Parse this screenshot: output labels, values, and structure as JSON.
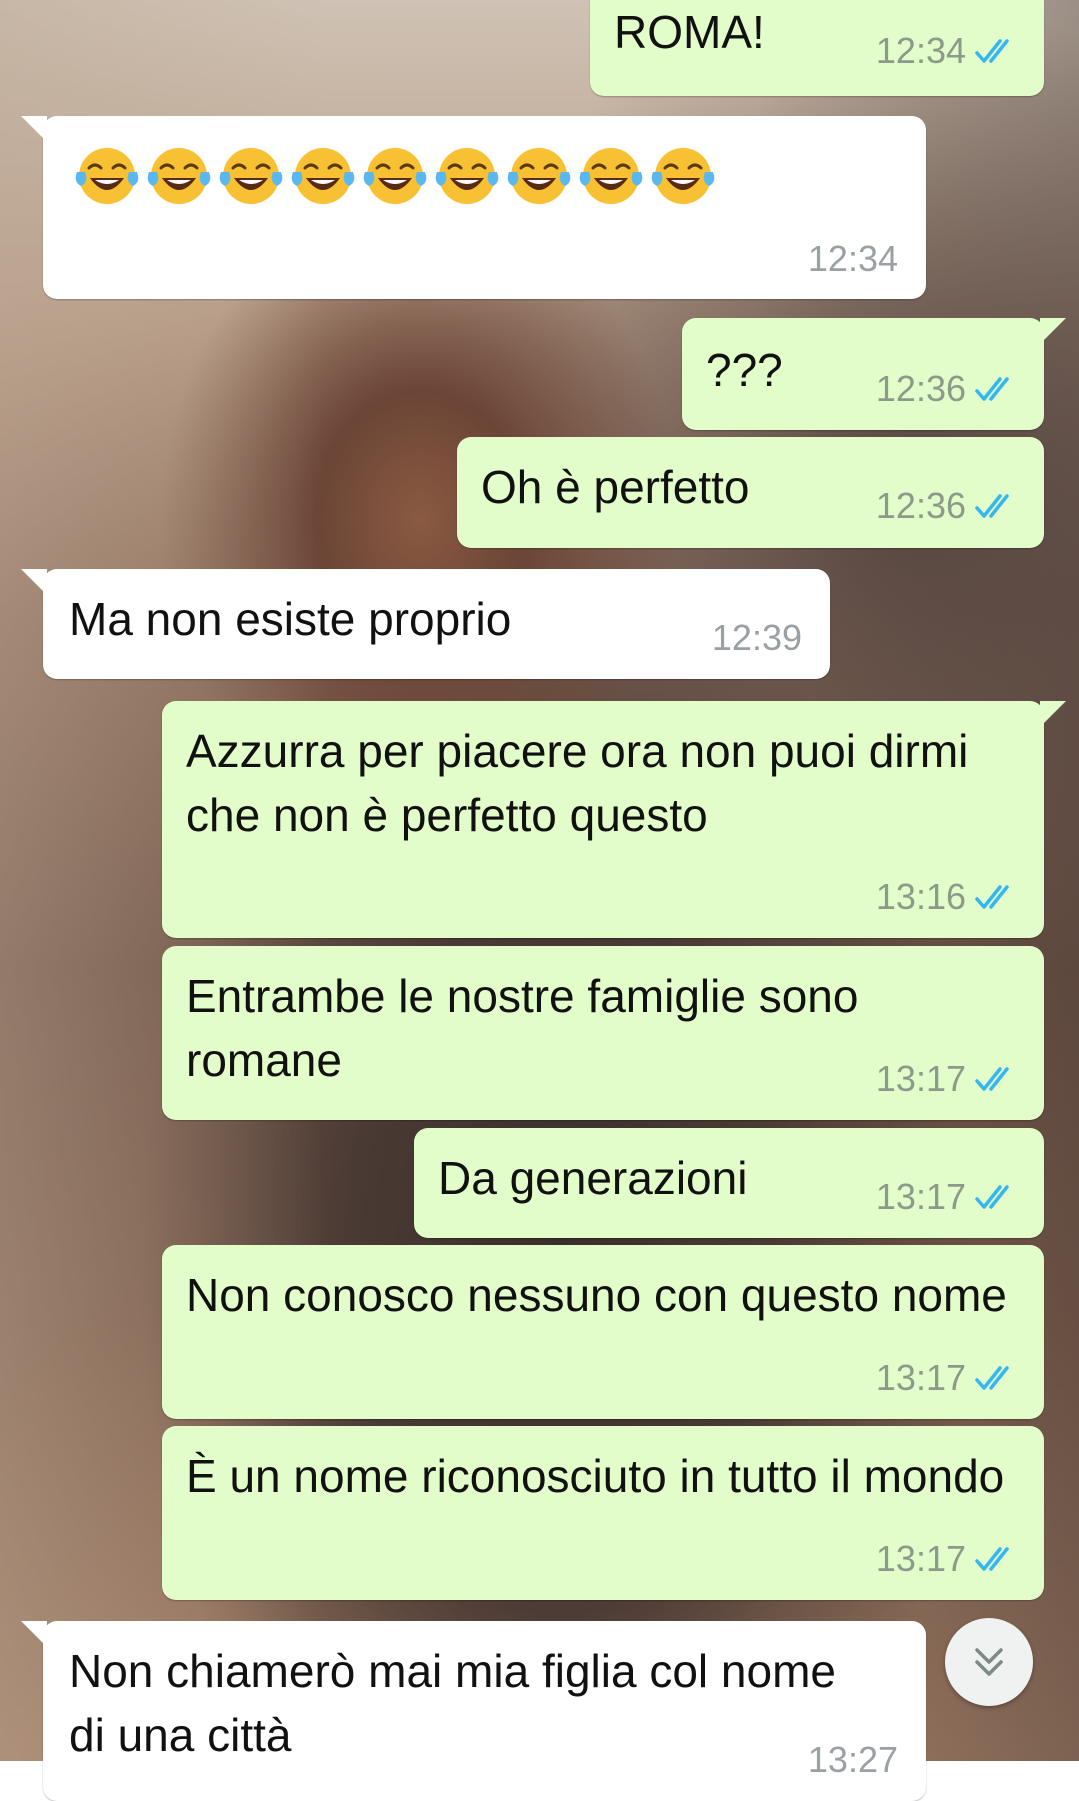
{
  "app": {
    "colors": {
      "outgoing_bubble": "#e2fdc9",
      "incoming_bubble": "#ffffff",
      "read_ticks": "#34b7f1"
    }
  },
  "messages": [
    {
      "direction": "out",
      "text": "ROMA!",
      "time": "12:34",
      "status": "read"
    },
    {
      "direction": "in",
      "text": "😂😂😂😂😂😂😂😂😂",
      "emoji_name": "face-with-tears-of-joy",
      "emoji_count": 9,
      "time": "12:34"
    },
    {
      "direction": "out",
      "text": "???",
      "time": "12:36",
      "status": "read"
    },
    {
      "direction": "out",
      "text": "Oh è perfetto",
      "time": "12:36",
      "status": "read"
    },
    {
      "direction": "in",
      "text": "Ma non esiste proprio",
      "time": "12:39"
    },
    {
      "direction": "out",
      "text": "Azzurra per piacere ora non puoi dirmi che non è perfetto questo",
      "time": "13:16",
      "status": "read"
    },
    {
      "direction": "out",
      "text": "Entrambe le nostre famiglie sono romane",
      "time": "13:17",
      "status": "read"
    },
    {
      "direction": "out",
      "text": "Da generazioni",
      "time": "13:17",
      "status": "read"
    },
    {
      "direction": "out",
      "text": "Non conosco nessuno con questo nome",
      "time": "13:17",
      "status": "read"
    },
    {
      "direction": "out",
      "text": "È un nome riconosciuto in tutto il mondo",
      "time": "13:17",
      "status": "read"
    },
    {
      "direction": "in",
      "text": "Non chiamerò mai mia figlia col nome di una città",
      "time": "13:27"
    }
  ],
  "scroll_button": {
    "icon": "double-chevron-down-icon"
  }
}
